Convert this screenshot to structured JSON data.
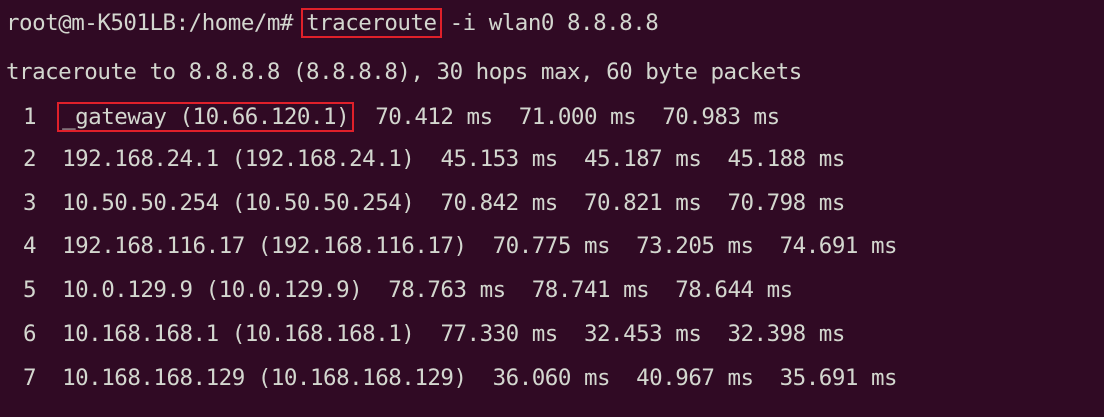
{
  "terminal": {
    "prompt": "root@m-K501LB:/home/m#",
    "command": "traceroute",
    "args": "-i wlan0 8.8.8.8",
    "header_line": "traceroute to 8.8.8.8 (8.8.8.8), 30 hops max, 60 byte packets",
    "hops": [
      {
        "num": "1",
        "host": "_gateway (10.66.120.1)",
        "times": "70.412 ms  71.000 ms  70.983 ms",
        "highlighted": true
      },
      {
        "num": "2",
        "host": "192.168.24.1 (192.168.24.1)",
        "times": "45.153 ms  45.187 ms  45.188 ms"
      },
      {
        "num": "3",
        "host": "10.50.50.254 (10.50.50.254)",
        "times": "70.842 ms  70.821 ms  70.798 ms"
      },
      {
        "num": "4",
        "host": "192.168.116.17 (192.168.116.17)",
        "times": "70.775 ms  73.205 ms  74.691 ms"
      },
      {
        "num": "5",
        "host": "10.0.129.9 (10.0.129.9)",
        "times": "78.763 ms  78.741 ms  78.644 ms"
      },
      {
        "num": "6",
        "host": "10.168.168.1 (10.168.168.1)",
        "times": "77.330 ms  32.453 ms  32.398 ms"
      },
      {
        "num": "7",
        "host": "10.168.168.129 (10.168.168.129)",
        "times": "36.060 ms  40.967 ms  35.691 ms"
      }
    ],
    "colors": {
      "background": "#300a24",
      "text": "#d3d7cf",
      "highlight_box": "#e0202a"
    }
  }
}
